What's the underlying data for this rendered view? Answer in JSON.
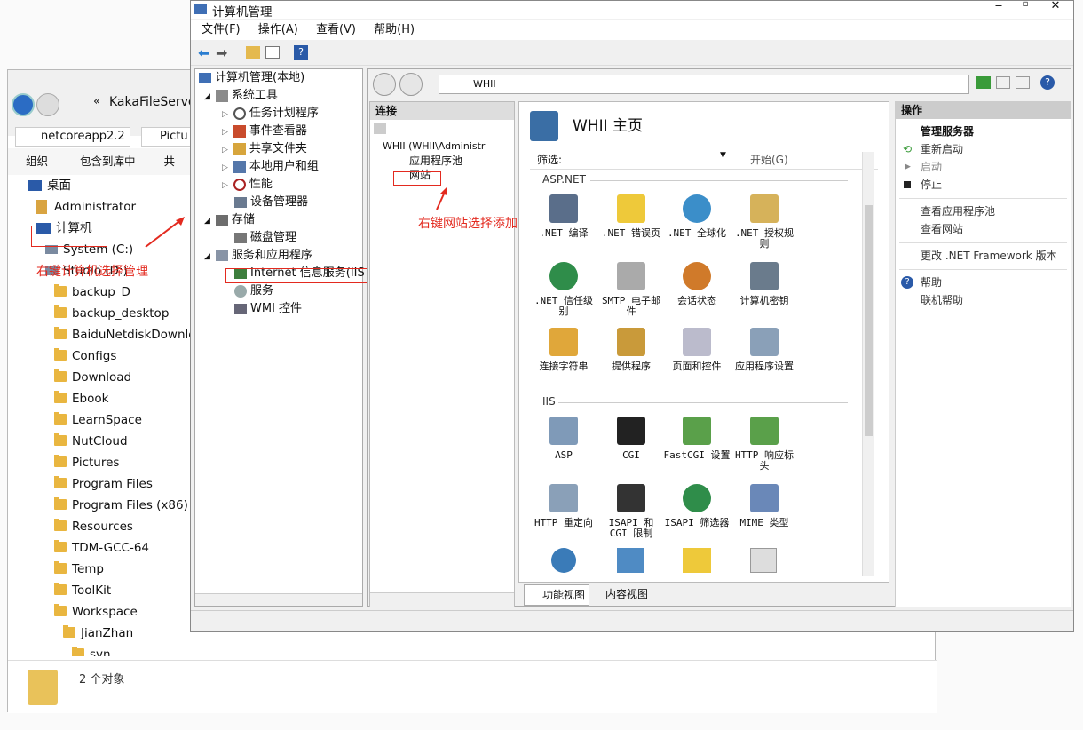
{
  "explorer": {
    "address": "KakaFileServer",
    "tabs": [
      "netcoreapp2.2",
      "Pictu"
    ],
    "toolbar": [
      "组织",
      "包含到库中",
      "共"
    ],
    "tree": [
      "桌面",
      "Administrator",
      "计算机",
      "System (C:)",
      "Studio (D:)",
      "backup_D",
      "backup_desktop",
      "BaiduNetdiskDownload",
      "Configs",
      "Download",
      "Ebook",
      "LearnSpace",
      "NutCloud",
      "Pictures",
      "Program Files",
      "Program Files (x86)",
      "Resources",
      "TDM-GCC-64",
      "Temp",
      "ToolKit",
      "Workspace",
      "JianZhan",
      "svn"
    ],
    "status": "2 个对象",
    "annotation": "右键计算机选择管理"
  },
  "mgmt": {
    "title": "计算机管理",
    "menu": [
      "文件(F)",
      "操作(A)",
      "查看(V)",
      "帮助(H)"
    ],
    "tree": {
      "root": "计算机管理(本地)",
      "items": [
        "系统工具",
        "任务计划程序",
        "事件查看器",
        "共享文件夹",
        "本地用户和组",
        "性能",
        "设备管理器",
        "存储",
        "磁盘管理",
        "服务和应用程序",
        "Internet 信息服务(IIS",
        "服务",
        "WMI 控件"
      ]
    },
    "iis": {
      "address": "WHII",
      "connections_title": "连接",
      "conn_tree": [
        "WHII (WHII\\Administr",
        "应用程序池",
        "网站"
      ],
      "annotation": "右键网站选择添加",
      "home_title": "WHII 主页",
      "filter_label": "筛选:",
      "start_label": "开始(G)",
      "group_aspnet": "ASP.NET",
      "aspnet": [
        ".NET 编译",
        ".NET 错误页",
        ".NET 全球化",
        ".NET 授权规则",
        ".NET 信任级别",
        "SMTP 电子邮件",
        "会话状态",
        "计算机密钥",
        "连接字符串",
        "提供程序",
        "页面和控件",
        "应用程序设置"
      ],
      "group_iis": "IIS",
      "iis_features": [
        "ASP",
        "CGI",
        "FastCGI 设置",
        "HTTP 响应标头",
        "HTTP 重定向",
        "ISAPI 和 CGI 限制",
        "ISAPI 筛选器",
        "MIME 类型"
      ],
      "tab_feature": "功能视图",
      "tab_content": "内容视图",
      "actions_title": "操作",
      "actions": [
        "管理服务器",
        "重新启动",
        "启动",
        "停止",
        "查看应用程序池",
        "查看网站",
        "更改 .NET Framework 版本",
        "帮助",
        "联机帮助"
      ]
    }
  }
}
